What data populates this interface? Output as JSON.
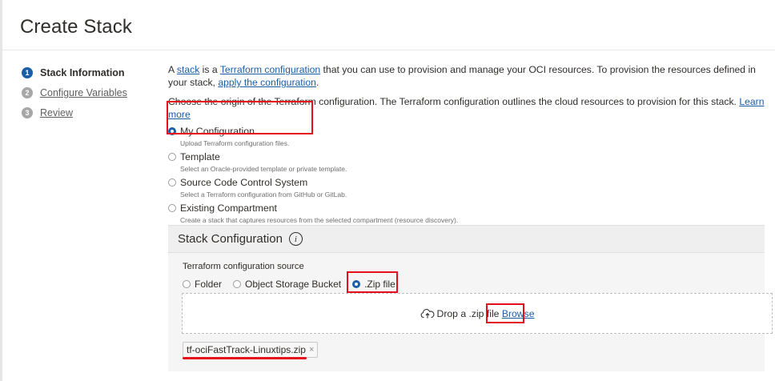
{
  "page": {
    "title": "Create Stack"
  },
  "steps": [
    {
      "num": "1",
      "label": "Stack Information"
    },
    {
      "num": "2",
      "label": "Configure Variables"
    },
    {
      "num": "3",
      "label": "Review"
    }
  ],
  "intro": {
    "text_a": "A ",
    "link_stack": "stack",
    "text_b": " is a ",
    "link_terraform": "Terraform configuration",
    "text_c": " that you can use to provision and manage your OCI resources. To provision the resources defined in your stack, ",
    "link_apply": "apply the configuration",
    "text_d": "."
  },
  "origin": {
    "text": "Choose the origin of the Terraform configuration. The Terraform configuration outlines the cloud resources to provision for this stack. ",
    "learn_more": "Learn more"
  },
  "origin_options": [
    {
      "title": "My Configuration",
      "desc": "Upload Terraform configuration files."
    },
    {
      "title": "Template",
      "desc": "Select an Oracle-provided template or private template."
    },
    {
      "title": "Source Code Control System",
      "desc": "Select a Terraform configuration from GitHub or GitLab."
    },
    {
      "title": "Existing Compartment",
      "desc": "Create a stack that captures resources from the selected compartment (resource discovery)."
    }
  ],
  "stack_config": {
    "heading": "Stack Configuration",
    "info_glyph": "i",
    "source_label": "Terraform configuration source",
    "sources": [
      "Folder",
      "Object Storage Bucket",
      ".Zip file"
    ],
    "drop_text": "Drop a .zip file",
    "browse": "Browse",
    "file_name": "tf-ociFastTrack-Linuxtips.zip",
    "remove_glyph": "×"
  },
  "colors": {
    "accent": "#1a5ea8",
    "highlight": "#e5101b"
  }
}
